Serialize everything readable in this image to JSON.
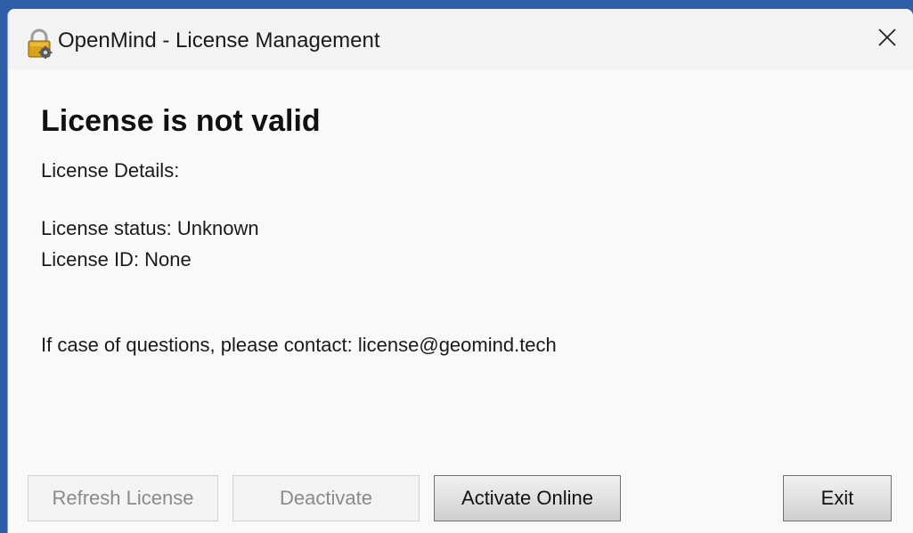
{
  "window": {
    "title": "OpenMind - License Management"
  },
  "content": {
    "heading": "License is not valid",
    "details_label": "License Details:",
    "status_line": "License status: Unknown",
    "id_line": "License ID: None",
    "contact_line": "If case of questions, please contact: license@geomind.tech"
  },
  "buttons": {
    "refresh": "Refresh License",
    "deactivate": "Deactivate",
    "activate": "Activate Online",
    "exit": "Exit"
  },
  "icons": {
    "app": "padlock-gear-icon",
    "close": "close-icon"
  }
}
